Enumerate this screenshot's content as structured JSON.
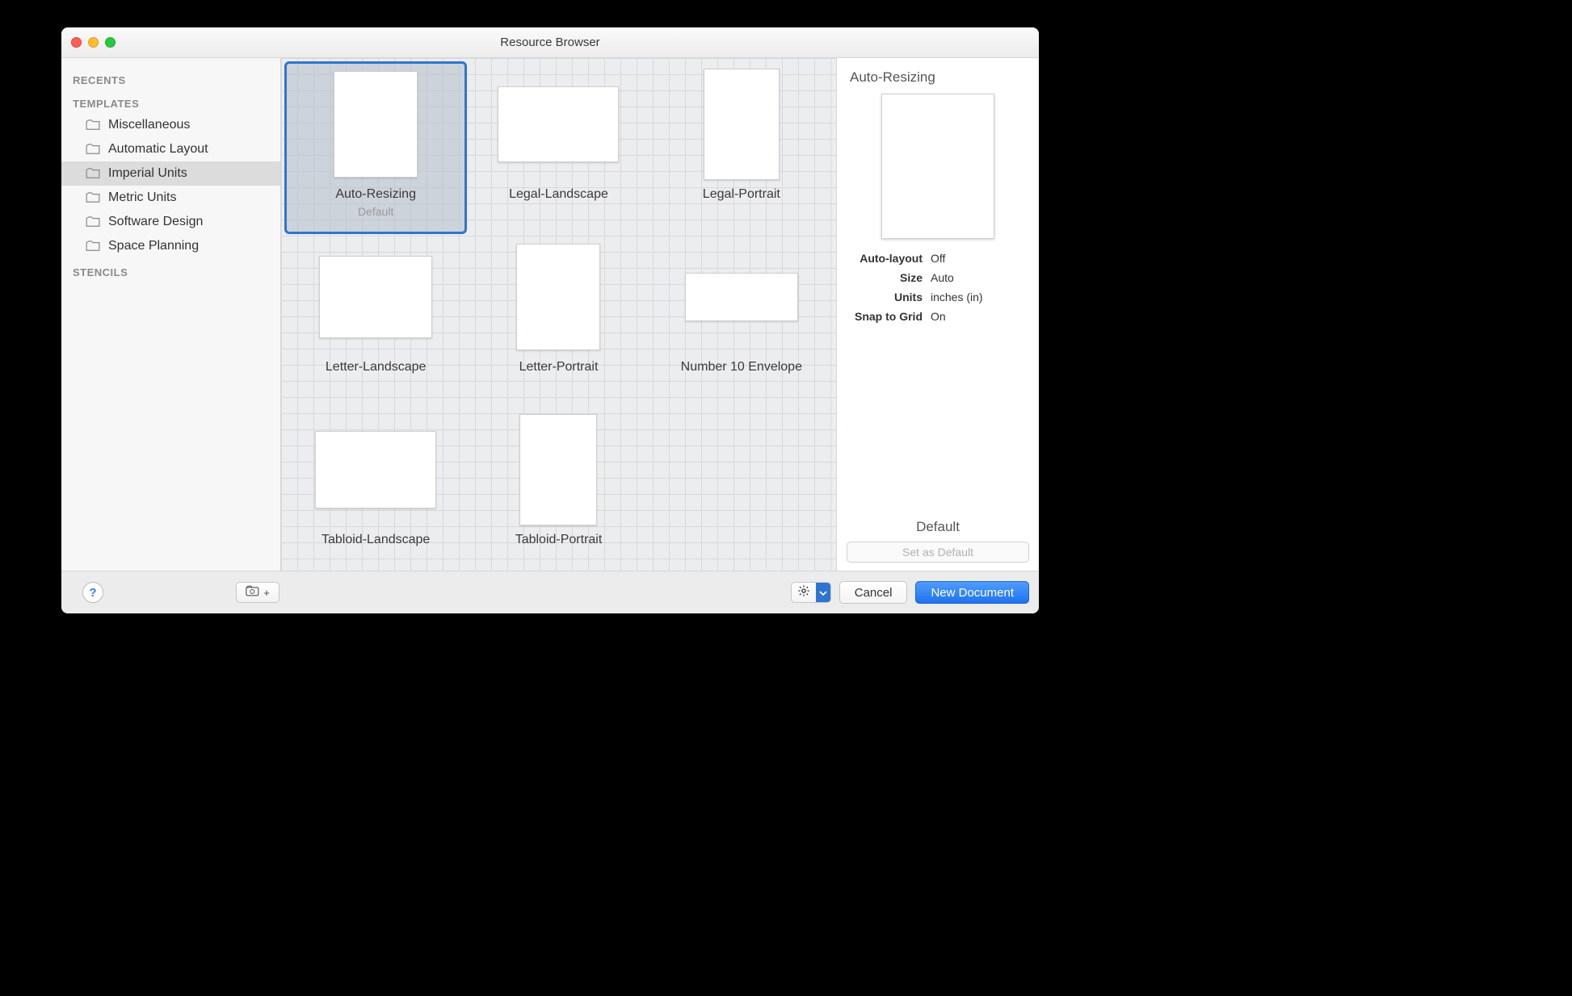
{
  "window": {
    "title": "Resource Browser"
  },
  "sidebar": {
    "recents_heading": "RECENTS",
    "templates_heading": "TEMPLATES",
    "stencils_heading": "STENCILS",
    "templates": [
      {
        "label": "Miscellaneous",
        "selected": false
      },
      {
        "label": "Automatic Layout",
        "selected": false
      },
      {
        "label": "Imperial Units",
        "selected": true
      },
      {
        "label": "Metric Units",
        "selected": false
      },
      {
        "label": "Software Design",
        "selected": false
      },
      {
        "label": "Space Planning",
        "selected": false
      }
    ]
  },
  "gallery": [
    {
      "name": "Auto-Resizing",
      "subtitle": "Default",
      "shape": "portrait",
      "selected": true
    },
    {
      "name": "Legal-Landscape",
      "subtitle": "",
      "shape": "legal-l",
      "selected": false
    },
    {
      "name": "Legal-Portrait",
      "subtitle": "",
      "shape": "legal-p",
      "selected": false
    },
    {
      "name": "Letter-Landscape",
      "subtitle": "",
      "shape": "landscape",
      "selected": false
    },
    {
      "name": "Letter-Portrait",
      "subtitle": "",
      "shape": "portrait",
      "selected": false
    },
    {
      "name": "Number 10 Envelope",
      "subtitle": "",
      "shape": "envelope",
      "selected": false
    },
    {
      "name": "Tabloid-Landscape",
      "subtitle": "",
      "shape": "tabloid-l",
      "selected": false
    },
    {
      "name": "Tabloid-Portrait",
      "subtitle": "",
      "shape": "tabloid-p",
      "selected": false
    }
  ],
  "details": {
    "title": "Auto-Resizing",
    "props": {
      "auto_layout_label": "Auto-layout",
      "auto_layout_value": "Off",
      "size_label": "Size",
      "size_value": "Auto",
      "units_label": "Units",
      "units_value": "inches (in)",
      "snap_label": "Snap to Grid",
      "snap_value": "On"
    },
    "default_label": "Default",
    "set_default_button": "Set as Default"
  },
  "footer": {
    "cancel": "Cancel",
    "new_document": "New Document"
  }
}
